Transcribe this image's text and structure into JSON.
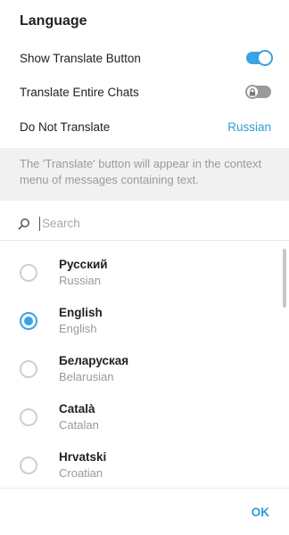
{
  "dialog": {
    "title": "Language",
    "settings": {
      "show_translate_button": {
        "label": "Show Translate Button",
        "state": "on"
      },
      "translate_entire_chats": {
        "label": "Translate Entire Chats",
        "state": "locked-off"
      },
      "do_not_translate": {
        "label": "Do Not Translate",
        "value": "Russian"
      }
    },
    "info": "The 'Translate' button will appear in the context menu of messages containing text.",
    "search": {
      "placeholder": "Search",
      "value": ""
    },
    "languages": [
      {
        "native": "Русский",
        "english": "Russian",
        "selected": false
      },
      {
        "native": "English",
        "english": "English",
        "selected": true
      },
      {
        "native": "Беларуская",
        "english": "Belarusian",
        "selected": false
      },
      {
        "native": "Català",
        "english": "Catalan",
        "selected": false
      },
      {
        "native": "Hrvatski",
        "english": "Croatian",
        "selected": false
      }
    ],
    "ok_label": "OK"
  },
  "colors": {
    "accent": "#3ba3e3",
    "link": "#2e9bd8",
    "muted": "#9a9a9a"
  }
}
